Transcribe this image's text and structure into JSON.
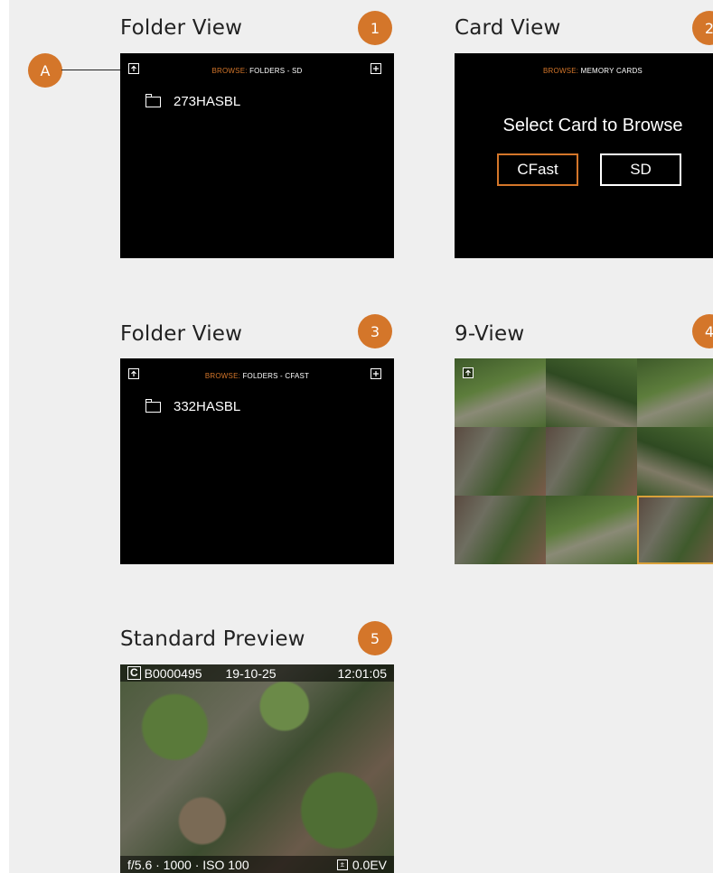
{
  "panels": {
    "p1": {
      "title": "Folder View",
      "badge": "1",
      "header_kw": "BROWSE:",
      "header_text": " FOLDERS - SD",
      "folder": "273HASBL"
    },
    "p2": {
      "title": "Card View",
      "badge": "2",
      "header_kw": "BROWSE:",
      "header_text": " MEMORY CARDS",
      "prompt": "Select Card to Browse",
      "cards": [
        "CFast",
        "SD"
      ],
      "selected": "CFast"
    },
    "p3": {
      "title": "Folder View",
      "badge": "3",
      "header_kw": "BROWSE:",
      "header_text": " FOLDERS - CFAST",
      "folder": "332HASBL"
    },
    "p4": {
      "title": "9-View",
      "badge": "4"
    },
    "p5": {
      "title": "Standard Preview",
      "badge": "5",
      "card_letter": "C",
      "image_id": "B0000495",
      "date": "19-10-25",
      "time": "12:01:05",
      "exposure": "f/5.6 · 1000 · ISO 100",
      "ev": "0.0EV"
    }
  },
  "callout": {
    "label": "A"
  },
  "colors": {
    "accent": "#d4762a",
    "screen": "#000000",
    "page": "#efefef"
  },
  "icons": {
    "up": "folder-up-icon",
    "add": "add-folder-icon",
    "folder": "folder-icon",
    "ev": "exposure-compensation-icon"
  }
}
